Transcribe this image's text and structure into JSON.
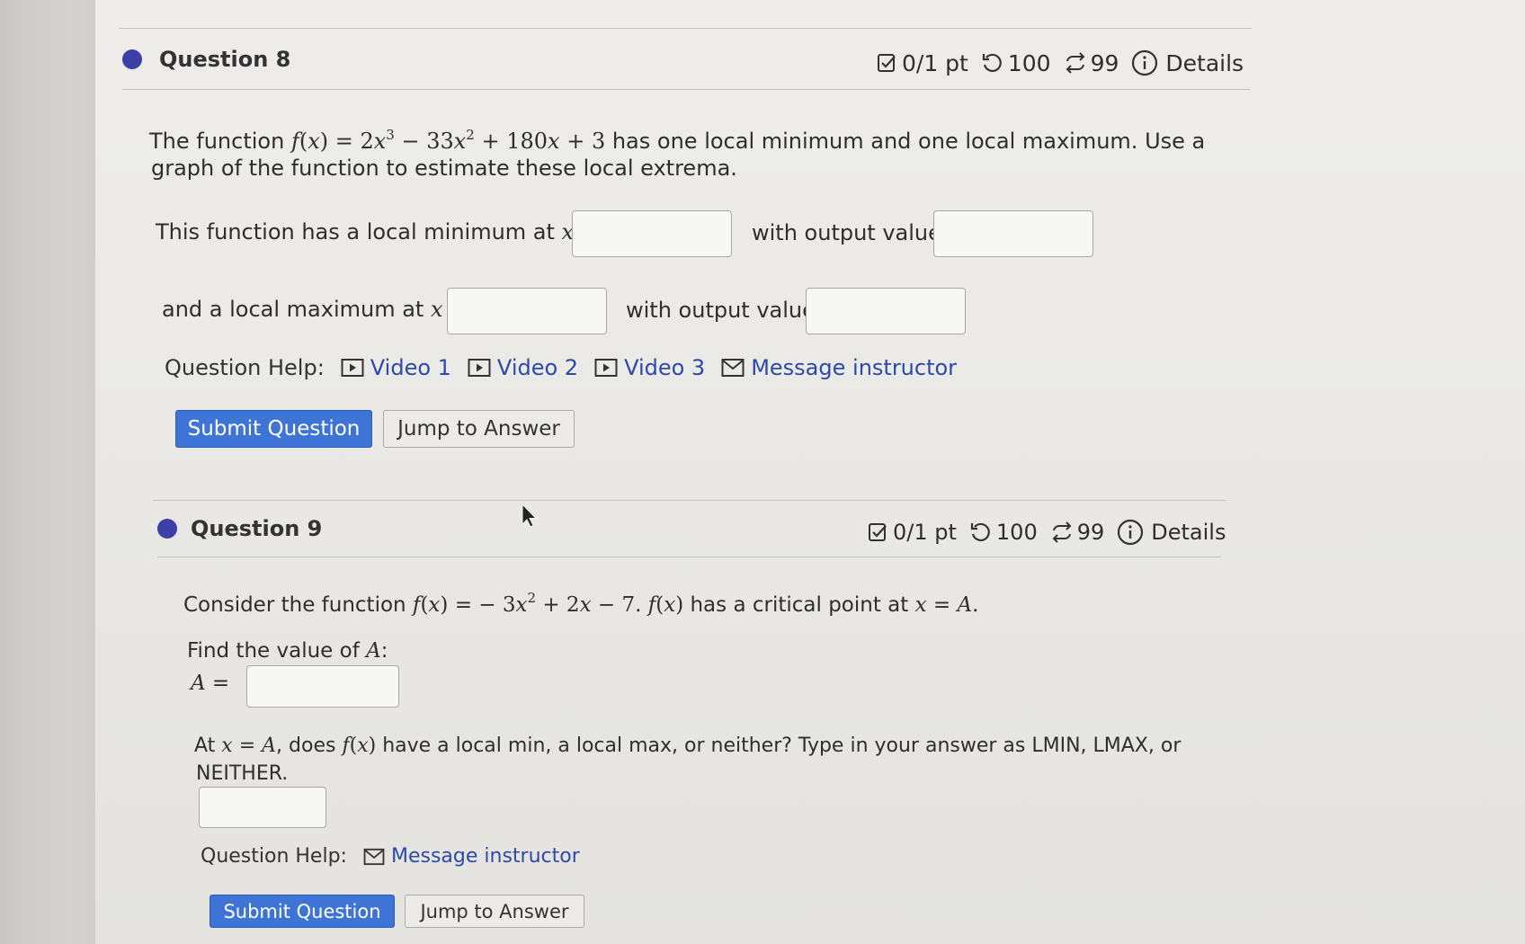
{
  "colors": {
    "accent": "#3b3fa6",
    "link": "#2c4aa6",
    "primary_button": "#3d74d6"
  },
  "q8": {
    "title": "Question 8",
    "points": "0/1 pt",
    "attempts": "100",
    "retries": "99",
    "details": "Details",
    "intro_a": "The function ",
    "intro_b": " has one local minimum and one local maximum. Use a",
    "intro_line2": "graph of the function to estimate these local extrema.",
    "min_label": "This function has a local minimum at ",
    "min_output_label": "with output value",
    "max_label": "and a local maximum at ",
    "max_output_label": "with output value",
    "min_x_value": "",
    "min_y_value": "",
    "max_x_value": "",
    "max_y_value": "",
    "help_label": "Question Help:",
    "help_links": [
      "Video 1",
      "Video 2",
      "Video 3",
      "Message instructor"
    ],
    "submit_label": "Submit Question",
    "jump_label": "Jump to Answer"
  },
  "q9": {
    "title": "Question 9",
    "points": "0/1 pt",
    "attempts": "100",
    "retries": "99",
    "details": "Details",
    "intro_a": "Consider the function ",
    "intro_b": " has a critical point at ",
    "find_a": "Find the value of ",
    "find_b": ":",
    "a_value": "",
    "part2_a": "At ",
    "part2_b": ", does ",
    "part2_c": " have a local min, a local max, or neither? Type in your answer as LMIN, LMAX, or",
    "part2_line2": "NEITHER.",
    "type_value": "",
    "help_label": "Question Help:",
    "help_links": [
      "Message instructor"
    ],
    "submit_label": "Submit Question",
    "jump_label": "Jump to Answer"
  }
}
